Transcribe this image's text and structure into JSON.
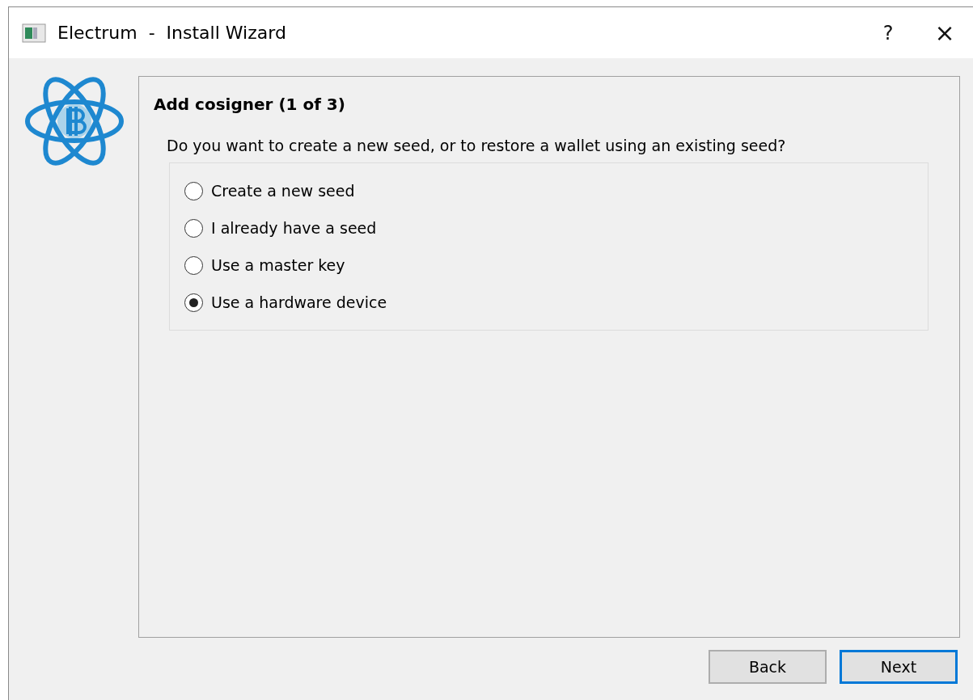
{
  "window": {
    "title": "Electrum  -  Install Wizard",
    "help": "?",
    "close": "×"
  },
  "page": {
    "title": "Add cosigner (1 of 3)",
    "question": "Do you want to create a new seed, or to restore a wallet using an existing seed?"
  },
  "options": [
    {
      "label": "Create a new seed",
      "selected": false
    },
    {
      "label": "I already have a seed",
      "selected": false
    },
    {
      "label": "Use a master key",
      "selected": false
    },
    {
      "label": "Use a hardware device",
      "selected": true
    }
  ],
  "buttons": [
    {
      "label": "Back",
      "focused": false
    },
    {
      "label": "Next",
      "focused": true
    }
  ]
}
